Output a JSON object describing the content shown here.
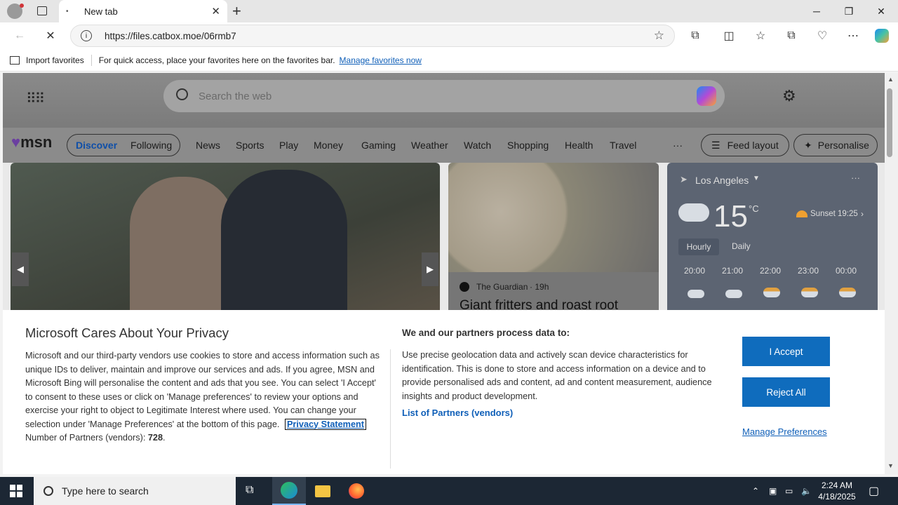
{
  "browser": {
    "tab_title": "New tab",
    "tab_favicon": "•",
    "url": "https://files.catbox.moe/06rmb7",
    "new_tab": "+",
    "favbar_import": "Import favorites",
    "favbar_hint": "For quick access, place your favorites here on the favorites bar.",
    "favbar_link": "Manage favorites now"
  },
  "msn": {
    "search_placeholder": "Search the web",
    "logo": "msn",
    "nav": [
      "Discover",
      "Following",
      "News",
      "Sports",
      "Play",
      "Money",
      "Gaming",
      "Weather",
      "Watch",
      "Shopping",
      "Health",
      "Travel",
      "···"
    ],
    "feed_layout": "Feed layout",
    "personalise": "Personalise",
    "article_source": "The Guardian",
    "article_age": "19h",
    "article_title": "Giant fritters and roast root",
    "weather": {
      "location": "Los Angeles",
      "temp": "15",
      "unit": "°C",
      "sunset": "Sunset 19:25",
      "tab_hourly": "Hourly",
      "tab_daily": "Daily",
      "hours": [
        "20:00",
        "21:00",
        "22:00",
        "23:00",
        "00:00"
      ],
      "more": "···"
    }
  },
  "privacy": {
    "title": "Microsoft Cares About Your Privacy",
    "body": "Microsoft and our third-party vendors use cookies to store and access information such as unique IDs to deliver, maintain and improve our services and ads. If you agree, MSN and Microsoft Bing will personalise the content and ads that you see. You can select 'I Accept' to consent to these uses or click on 'Manage preferences' to review your options and exercise your right to object to Legitimate Interest where used.  You can change your selection under 'Manage Preferences' at the bottom of this page.",
    "privacy_link": "Privacy Statement",
    "partners_label": "Number of Partners (vendors):",
    "partners_count": "728",
    "partners_period": ".",
    "right_title": "We and our partners process data to:",
    "right_body": "Use precise geolocation data and actively scan device characteristics for identification. This is done to store and access information on a device and to provide personalised ads and content, ad and content measurement, audience insights and product development.",
    "vendors_link": "List of Partners (vendors)",
    "accept": "I Accept",
    "reject": "Reject All",
    "manage": "Manage Preferences"
  },
  "taskbar": {
    "search": "Type here to search",
    "time": "2:24 AM",
    "date": "4/18/2025"
  },
  "colors": {
    "accent": "#0f6cbd",
    "link": "#0f5fb8",
    "taskbar": "#1c2734"
  }
}
